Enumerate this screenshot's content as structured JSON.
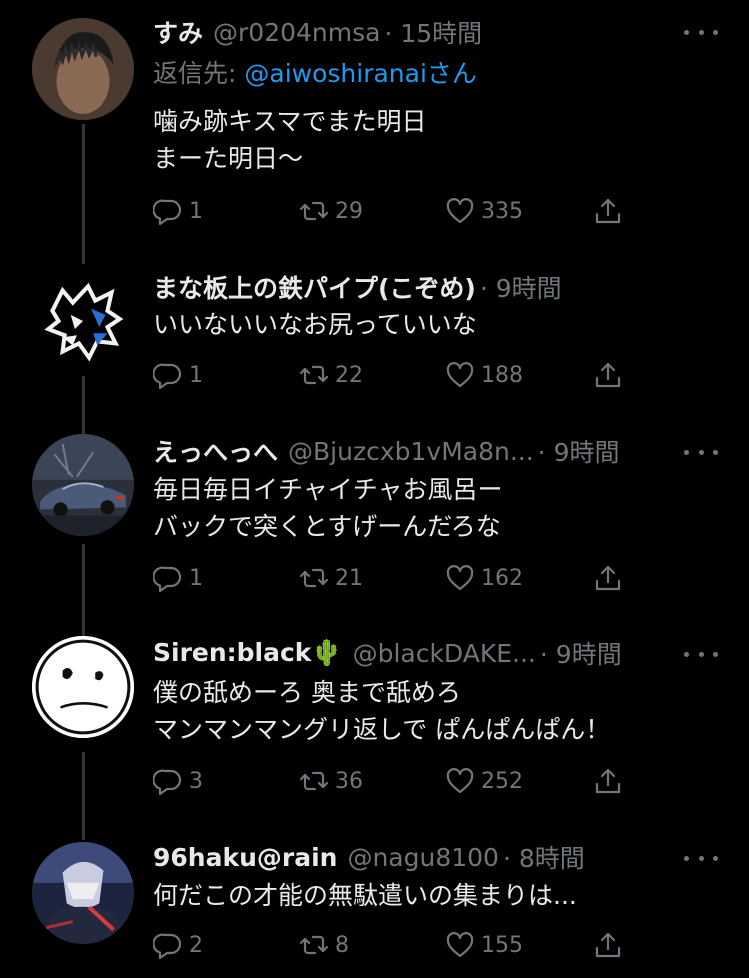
{
  "tweets": [
    {
      "name": "すみ",
      "handle": "@r0204nmsa",
      "time": "· 15時間",
      "reply_prefix": "返信先:",
      "reply_mention": "@aiwoshiranaiさん",
      "lines": [
        "噛み跡キスマでまた明日",
        "まーた明日〜"
      ],
      "replies": "1",
      "retweets": "29",
      "likes": "335",
      "avatar": "photo-avatar"
    },
    {
      "name": "まな板上の鉄パイプ(こぞめ)",
      "handle": "",
      "time": "· 9時間",
      "lines": [
        "いいないいなお尻っていいな"
      ],
      "replies": "1",
      "retweets": "22",
      "likes": "188",
      "avatar": "wolf-logo-avatar"
    },
    {
      "name": "えっへっへ",
      "handle": "@Bjuzcxb1vMa8n...",
      "time": "· 9時間",
      "lines": [
        "毎日毎日イチャイチャお風呂ー",
        "バックで突くとすげーんだろな"
      ],
      "replies": "1",
      "retweets": "21",
      "likes": "162",
      "avatar": "car-avatar"
    },
    {
      "name": "Siren:black🌵",
      "handle": "@blackDAKE...",
      "time": "· 9時間",
      "lines": [
        "僕の舐めーろ 奥まで舐めろ",
        "マンマンマングリ返しで ぱんぱんぱん！"
      ],
      "replies": "3",
      "retweets": "36",
      "likes": "252",
      "avatar": "sad-face-avatar"
    },
    {
      "name": "96haku@rain",
      "handle": "@nagu8100",
      "time": "· 8時間",
      "lines": [
        "何だこの才能の無駄遣いの集まりは..."
      ],
      "replies": "2",
      "retweets": "8",
      "likes": "155",
      "avatar": "anime-avatar"
    }
  ],
  "colors": {
    "background": "#000000",
    "text": "#e7e9ea",
    "muted": "#71767b",
    "link": "#1d9bf0",
    "thread": "#333639"
  }
}
